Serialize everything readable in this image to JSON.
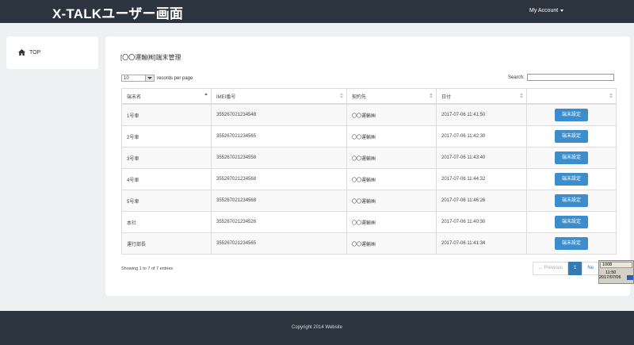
{
  "header": {
    "title": "X-TALKユーザー画面",
    "account_label": "My Account"
  },
  "sidebar": {
    "items": [
      {
        "label": "TOP",
        "icon": "home-icon"
      }
    ]
  },
  "main": {
    "title": "[〇〇運輸㈱]端末管理",
    "length": {
      "value": "10",
      "suffix": "records per page"
    },
    "search_label": "Search:",
    "search_value": "",
    "columns": [
      "端末名",
      "IMEI番号",
      "契約先",
      "日付",
      ""
    ],
    "rows": [
      [
        "1号車",
        "355267021234548",
        "〇〇運輸㈱",
        "2017-07-06 11:41:50",
        "端末設定"
      ],
      [
        "2号車",
        "355267021234565",
        "〇〇運輸㈱",
        "2017-07-06 11:42:30",
        "端末設定"
      ],
      [
        "3号車",
        "355267021234558",
        "〇〇運輸㈱",
        "2017-07-06 11:43:40",
        "端末設定"
      ],
      [
        "4号車",
        "355267021234568",
        "〇〇運輸㈱",
        "2017-07-06 11:44:32",
        "端末設定"
      ],
      [
        "5号車",
        "355267021234568",
        "〇〇運輸㈱",
        "2017-07-06 11:46:26",
        "端末設定"
      ],
      [
        "本社",
        "355267021234526",
        "〇〇運輸㈱",
        "2017-07-06 11:40:30",
        "端末設定"
      ],
      [
        "運行部長",
        "355267021234565",
        "〇〇運輸㈱",
        "2017-07-06 11:41:34",
        "端末設定"
      ]
    ],
    "info": "Showing 1 to 7 of 7 entries",
    "pagination": {
      "previous": "← Previous",
      "current": "1",
      "next": "Ne"
    }
  },
  "tray": {
    "ime": "1008",
    "time": "11:50",
    "date": "2017/07/06"
  },
  "footer": {
    "text": "Copyright 2014 Website"
  },
  "colors": {
    "nav": "#2c3440",
    "accent": "#3c8dcb",
    "background": "#eef0f2"
  }
}
